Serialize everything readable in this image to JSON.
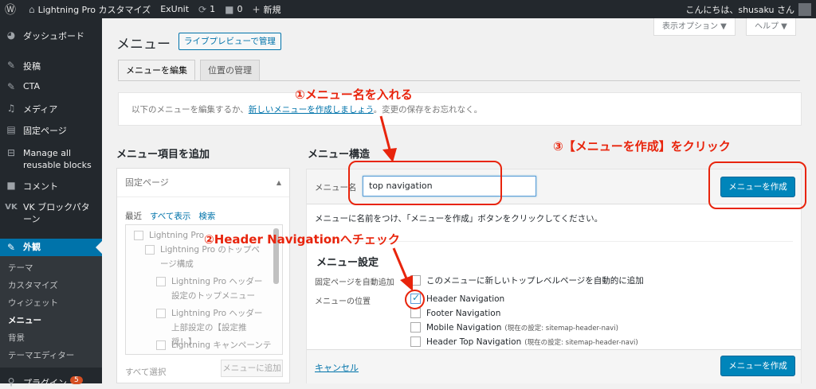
{
  "adminbar": {
    "site_name": "Lightning Pro カスタマイズ",
    "exunit": "ExUnit",
    "updates_count": "1",
    "comments_count": "0",
    "new_label": "新規",
    "greeting": "こんにちは、shusaku さん"
  },
  "sidebar": {
    "items": [
      {
        "label": "ダッシュボード"
      },
      {
        "label": "投稿"
      },
      {
        "label": "CTA"
      },
      {
        "label": "メディア"
      },
      {
        "label": "固定ページ"
      },
      {
        "label": "Manage all reusable blocks"
      },
      {
        "label": "コメント"
      },
      {
        "label": "VK ブロックパターン"
      },
      {
        "label": "外観"
      }
    ],
    "submenu": [
      "テーマ",
      "カスタマイズ",
      "ウィジェット",
      "メニュー",
      "背景",
      "テーマエディター"
    ],
    "bottom_item": "プラグイン",
    "plugin_badge": "5"
  },
  "header": {
    "title": "メニュー",
    "live_preview": "ライブプレビューで管理",
    "screen_options": "表示オプション ▼",
    "help": "ヘルプ ▼"
  },
  "tabs": [
    "メニューを編集",
    "位置の管理"
  ],
  "notice": {
    "prefix": "以下のメニューを編集するか、",
    "link": "新しいメニューを作成しましょう",
    "suffix": "。変更の保存をお忘れなく。"
  },
  "add_items": {
    "heading": "メニュー項目を追加",
    "accordion_title": "固定ページ",
    "sub_tabs": [
      "最近",
      "すべて表示",
      "検索"
    ],
    "pages": [
      "Lightning Pro",
      "Lightning Pro のトップページ構成",
      "Lightning Pro ヘッダー設定のトップメニュー",
      "Lightning Pro ヘッダー上部設定の【設定推奨！】",
      "Lightning キャンペーンテ"
    ],
    "select_all": "すべて選択",
    "add_button": "メニューに追加"
  },
  "structure": {
    "heading": "メニュー構造",
    "name_label": "メニュー名",
    "name_value": "top navigation",
    "create_button": "メニューを作成",
    "hint": "メニューに名前をつけ、「メニューを作成」ボタンをクリックしてください。",
    "settings_heading": "メニュー設定",
    "auto_add_label": "固定ページを自動追加",
    "auto_add_option": "このメニューに新しいトップレベルページを自動的に追加",
    "location_label": "メニューの位置",
    "locations": [
      {
        "name": "Header Navigation",
        "note": "",
        "checked": true
      },
      {
        "name": "Footer Navigation",
        "note": "",
        "checked": false
      },
      {
        "name": "Mobile Navigation",
        "note": "(現在の設定: sitemap-header-navi)",
        "checked": false
      },
      {
        "name": "Header Top Navigation",
        "note": "(現在の設定: sitemap-header-navi)",
        "checked": false
      }
    ],
    "cancel": "キャンセル",
    "create_button_bottom": "メニューを作成"
  },
  "annotations": {
    "step1": "①メニュー名を入れる",
    "step2": "②Header Navigationへチェック",
    "step3": "③【メニューを作成】をクリック"
  },
  "colors": {
    "annotation_red": "#e8240c",
    "wp_blue": "#0073aa",
    "button_blue": "#0085ba",
    "admin_dark": "#23282d"
  }
}
